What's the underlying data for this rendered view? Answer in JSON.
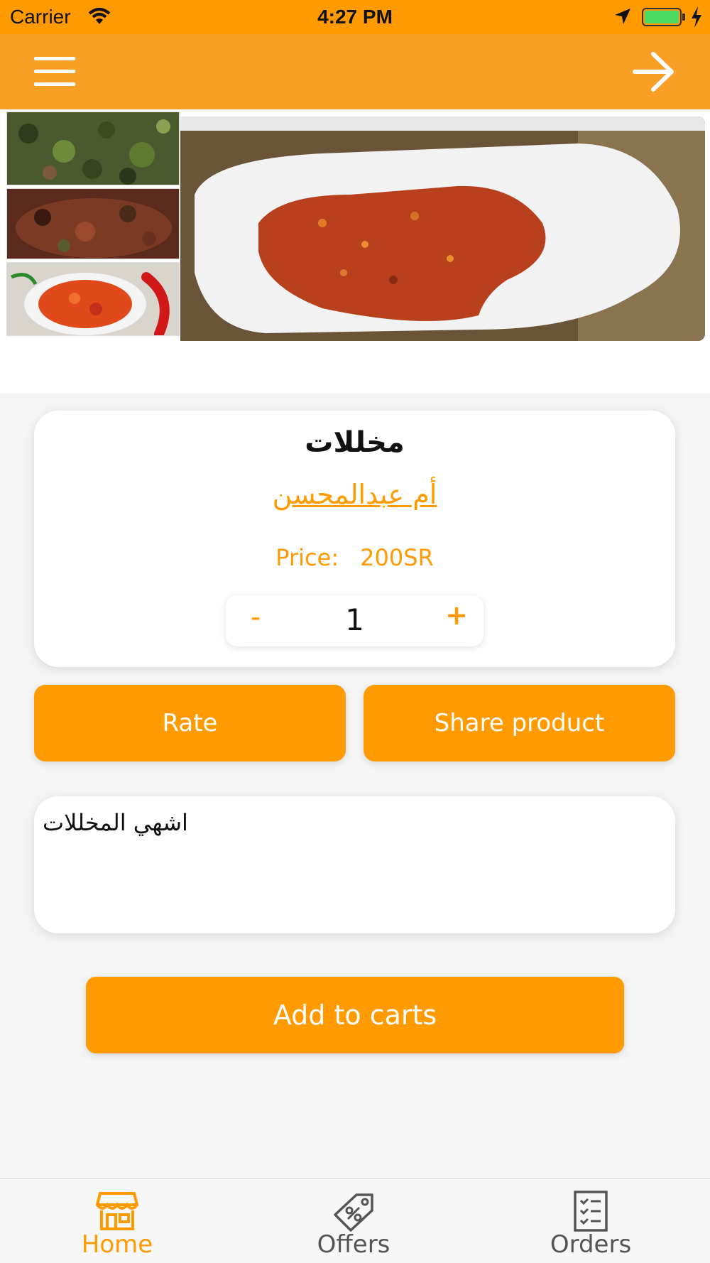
{
  "status_bar": {
    "carrier": "Carrier",
    "time": "4:27 PM"
  },
  "nav": {
    "menu_icon": "hamburger-menu-icon",
    "forward_icon": "arrow-right-icon"
  },
  "gallery": {
    "thumbnails": [
      "pickled-peppers-photo",
      "spice-mix-photo",
      "red-chili-flakes-photo"
    ],
    "main_image": "chili-sauce-in-white-dish-photo"
  },
  "product": {
    "title": "مخللات",
    "vendor": "أم عبدالمحسن",
    "price_label": "Price:",
    "price_value": "200SR",
    "quantity": "1",
    "minus_label": "-",
    "plus_label": "+"
  },
  "actions": {
    "rate_label": "Rate",
    "share_label": "Share product"
  },
  "description": "اشهي المخللات",
  "add_to_cart_label": "Add to carts",
  "tabs": [
    {
      "label": "Home",
      "icon": "store-icon",
      "active": true
    },
    {
      "label": "Offers",
      "icon": "tag-icon",
      "active": false
    },
    {
      "label": "Orders",
      "icon": "list-icon",
      "active": false
    }
  ],
  "colors": {
    "accent": "#ff9a00",
    "nav_bar": "#fa9f25",
    "inactive_tab": "#555555"
  }
}
